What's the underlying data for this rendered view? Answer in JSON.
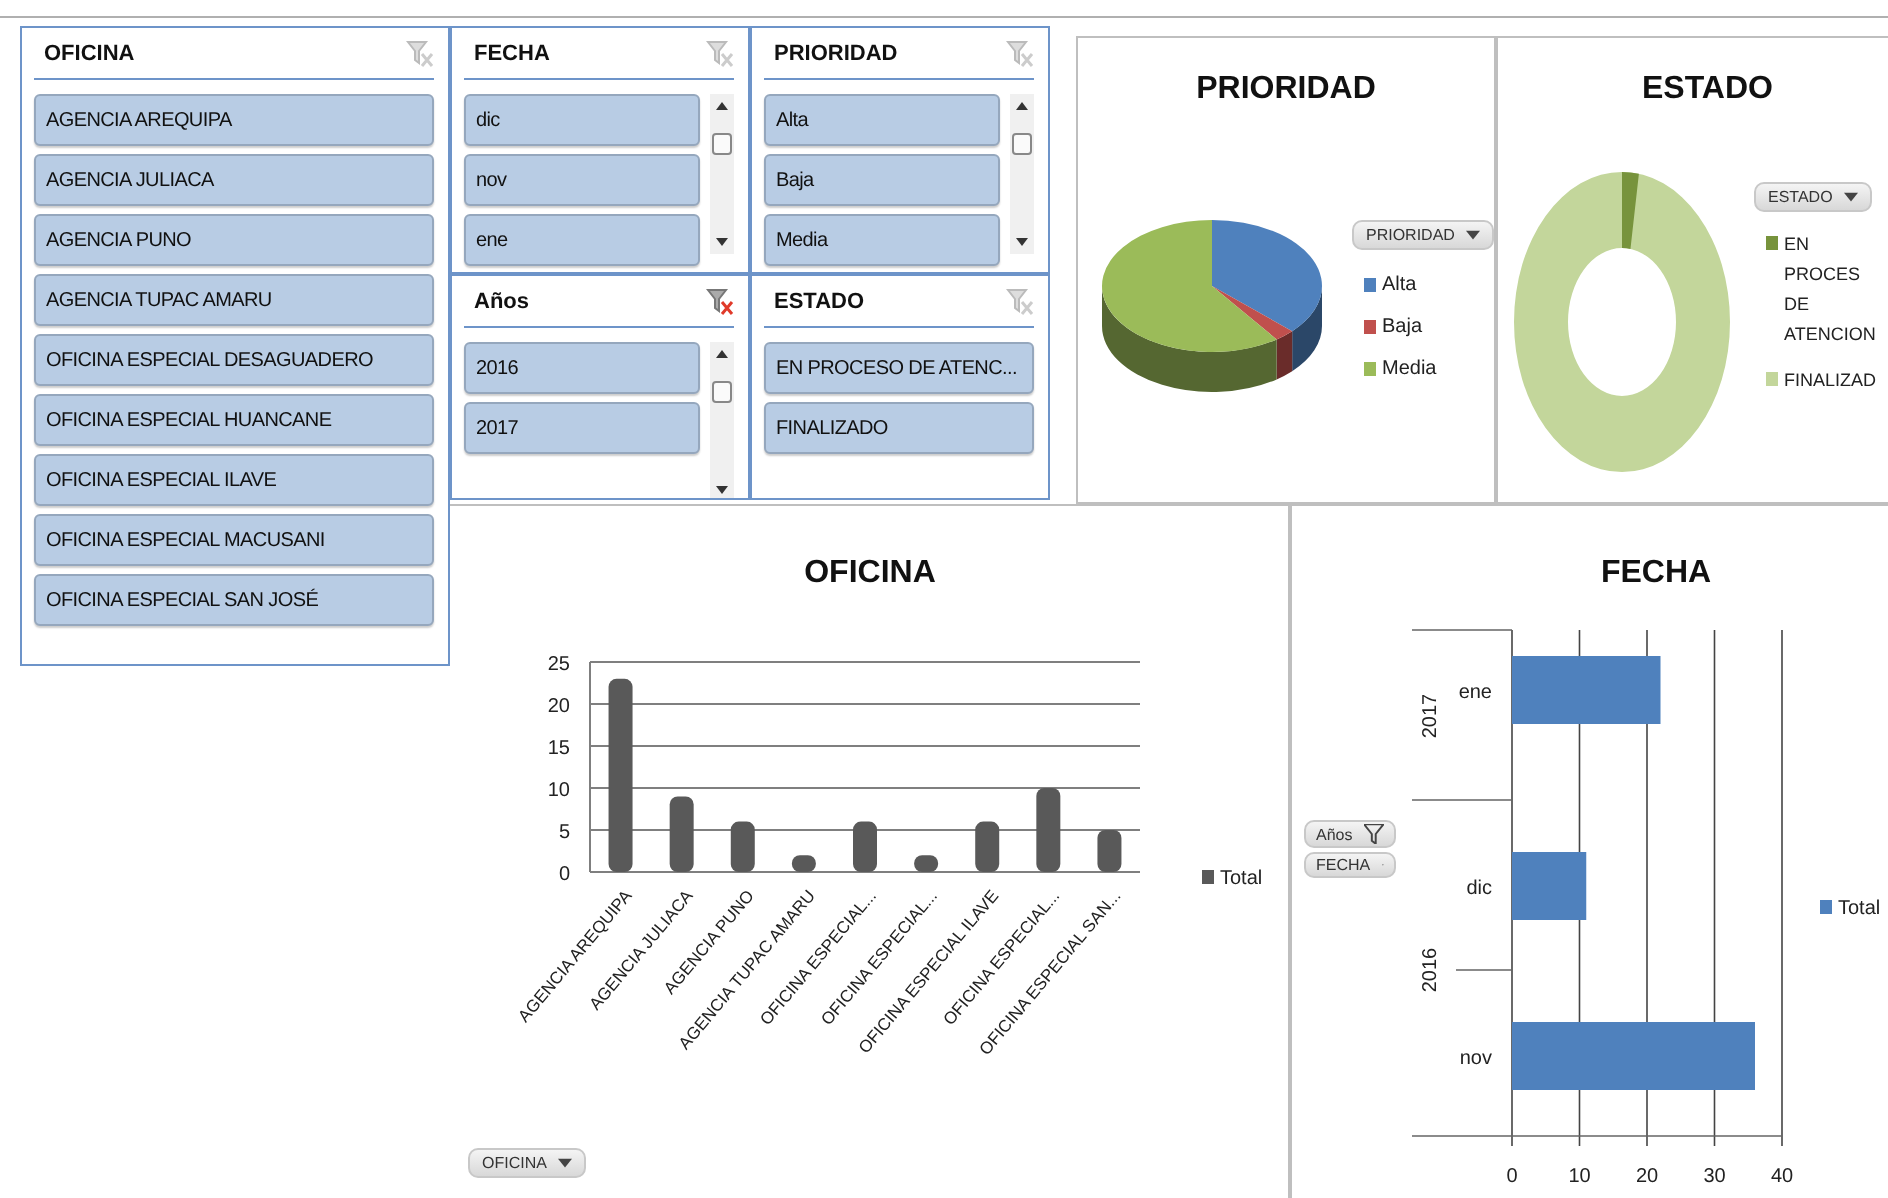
{
  "slicers": [
    {
      "title": "OFICINA",
      "filtered": false,
      "scrollbar": false,
      "items": [
        {
          "label": "AGENCIA AREQUIPA",
          "selected": true
        },
        {
          "label": "AGENCIA JULIACA",
          "selected": true
        },
        {
          "label": "AGENCIA PUNO",
          "selected": true
        },
        {
          "label": "AGENCIA TUPAC AMARU",
          "selected": true
        },
        {
          "label": "OFICINA ESPECIAL DESAGUADERO",
          "selected": true
        },
        {
          "label": "OFICINA ESPECIAL HUANCANE",
          "selected": true
        },
        {
          "label": "OFICINA ESPECIAL ILAVE",
          "selected": true
        },
        {
          "label": "OFICINA ESPECIAL MACUSANI",
          "selected": true
        },
        {
          "label": "OFICINA ESPECIAL SAN JOSÉ",
          "selected": true
        }
      ]
    },
    {
      "title": "FECHA",
      "filtered": false,
      "scrollbar": true,
      "items": [
        {
          "label": "dic",
          "selected": true
        },
        {
          "label": "nov",
          "selected": true
        },
        {
          "label": "ene",
          "selected": true
        }
      ]
    },
    {
      "title": "PRIORIDAD",
      "filtered": false,
      "scrollbar": true,
      "items": [
        {
          "label": "Alta",
          "selected": true
        },
        {
          "label": "Baja",
          "selected": true
        },
        {
          "label": "Media",
          "selected": true
        }
      ]
    },
    {
      "title": "Años",
      "filtered": true,
      "scrollbar": true,
      "items": [
        {
          "label": "2016",
          "selected": true
        },
        {
          "label": "2017",
          "selected": true
        }
      ]
    },
    {
      "title": "ESTADO",
      "filtered": false,
      "scrollbar": false,
      "items": [
        {
          "label": "EN PROCESO DE ATENC...",
          "selected": true
        },
        {
          "label": "FINALIZADO",
          "selected": true
        }
      ]
    }
  ],
  "prioridad_chart": {
    "title": "PRIORIDAD",
    "field_button": "PRIORIDAD",
    "legend": [
      {
        "label": "Alta",
        "color": "#4f81bd"
      },
      {
        "label": "Baja",
        "color": "#c0504d"
      },
      {
        "label": "Media",
        "color": "#9bbb59"
      }
    ]
  },
  "estado_chart": {
    "title": "ESTADO",
    "field_button": "ESTADO",
    "legend": [
      {
        "label": "EN PROCES DE ATENCION",
        "color": "#77933c"
      },
      {
        "label": "FINALIZAD",
        "color": "#c3d69b"
      }
    ]
  },
  "oficina_chart": {
    "field_button": "OFICINA",
    "chart_data": {
      "type": "bar",
      "title": "OFICINA",
      "categories": [
        "AGENCIA AREQUIPA",
        "AGENCIA JULIACA",
        "AGENCIA PUNO",
        "AGENCIA TUPAC AMARU",
        "OFICINA ESPECIAL...",
        "OFICINA ESPECIAL...",
        "OFICINA ESPECIAL ILAVE",
        "OFICINA ESPECIAL...",
        "OFICINA ESPECIAL SAN..."
      ],
      "series": [
        {
          "name": "Total",
          "color": "#595959",
          "values": [
            23,
            9,
            6,
            2,
            6,
            2,
            6,
            10,
            5
          ]
        }
      ],
      "ylim": [
        0,
        25
      ],
      "yticks": [
        0,
        5,
        10,
        15,
        20,
        25
      ],
      "grid": true
    }
  },
  "fecha_chart": {
    "field_buttons": [
      {
        "label": "Años",
        "filtered": true
      },
      {
        "label": "FECHA",
        "filtered": false
      }
    ],
    "year_labels": [
      "2017",
      "2016"
    ],
    "chart_data": {
      "type": "bar",
      "orientation": "horizontal",
      "title": "FECHA",
      "categories": [
        "ene",
        "dic",
        "nov"
      ],
      "series": [
        {
          "name": "Total",
          "color": "#4f81bd",
          "values": [
            22,
            11,
            36
          ]
        }
      ],
      "xlim": [
        0,
        40
      ],
      "xticks": [
        0,
        10,
        20,
        30,
        40
      ],
      "grid": true
    }
  }
}
